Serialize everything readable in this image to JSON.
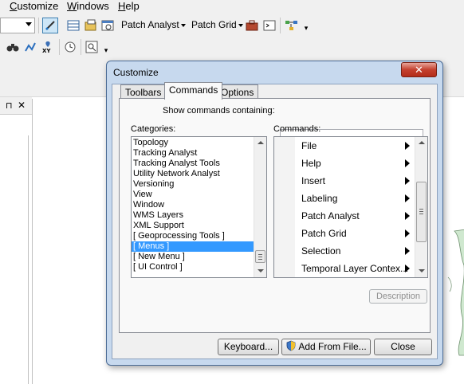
{
  "menubar": {
    "items": [
      {
        "label": "Customize",
        "ul": "C",
        "rest": "ustomize"
      },
      {
        "label": "Windows",
        "ul": "W",
        "rest": "indows"
      },
      {
        "label": "Help",
        "ul": "H",
        "rest": "elp"
      }
    ]
  },
  "toolbar": {
    "patch_analyst_menu": "Patch Analyst",
    "patch_grid_menu": "Patch Grid"
  },
  "dialog": {
    "title": "Customize",
    "close_glyph": "✕",
    "tabs": [
      "Toolbars",
      "Commands",
      "Options"
    ],
    "active_tab": "Commands",
    "search_label": "Show commands containing:",
    "search_value": "",
    "categories_label": "Categories:",
    "commands_label": "Commands:",
    "categories": [
      "Topology",
      "Tracking Analyst",
      "Tracking Analyst Tools",
      "Utility Network Analyst",
      "Versioning",
      "View",
      "Window",
      "WMS Layers",
      "XML Support",
      "[ Geoprocessing Tools ]",
      "[ Menus ]",
      "[ New Menu ]",
      "[ UI Control ]"
    ],
    "selected_category": "[ Menus ]",
    "commands": [
      "File",
      "Help",
      "Insert",
      "Labeling",
      "Patch Analyst",
      "Patch Grid",
      "Selection",
      "Temporal Layer Contex..."
    ],
    "description_button": "Description",
    "keyboard_button": "Keyboard...",
    "add_from_file_button": "Add From File...",
    "close_button": "Close"
  },
  "colors": {
    "selection": "#3399ff",
    "dialog_frame": "#c7d9ee",
    "close_red": "#c4402e"
  }
}
